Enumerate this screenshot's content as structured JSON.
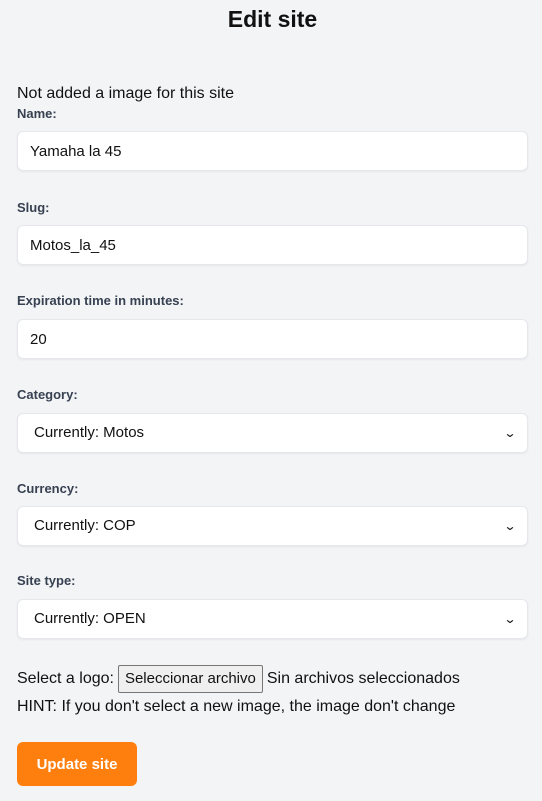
{
  "page_title": "Edit site",
  "no_image_text": "Not added a image for this site",
  "fields": {
    "name": {
      "label": "Name:",
      "value": "Yamaha la 45"
    },
    "slug": {
      "label": "Slug:",
      "value": "Motos_la_45"
    },
    "expiration": {
      "label": "Expiration time in minutes:",
      "value": "20"
    },
    "category": {
      "label": "Category:",
      "selected": "Currently: Motos"
    },
    "currency": {
      "label": "Currency:",
      "selected": "Currently: COP"
    },
    "site_type": {
      "label": "Site type:",
      "selected": "Currently: OPEN"
    }
  },
  "logo": {
    "label": "Select a logo:",
    "button": "Seleccionar archivo",
    "status": "Sin archivos seleccionados",
    "hint": "HINT: If you don't select a new image, the image don't change"
  },
  "submit_label": "Update site",
  "colors": {
    "accent": "#ff7f0e",
    "background": "#f3f4f6"
  }
}
